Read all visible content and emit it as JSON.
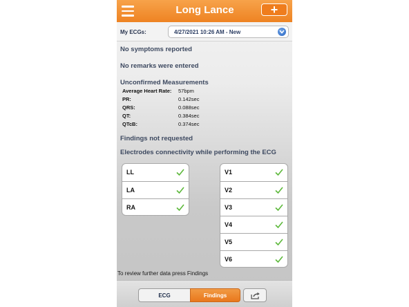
{
  "header": {
    "title": "Long Lance",
    "add_label": "+",
    "menu_icon": "hamburger-menu-icon"
  },
  "ecg_selector": {
    "label": "My ECGs:",
    "selected": "4/27/2021 10:26 AM - New",
    "icon": "chevron-down-circle-icon"
  },
  "notes": {
    "symptoms": "No symptoms reported",
    "remarks": "No remarks were entered"
  },
  "measurements": {
    "heading": "Unconfirmed Measurements",
    "rows": [
      {
        "label": "Average Heart Rate:",
        "value": "57bpm"
      },
      {
        "label": "PR:",
        "value": "0.142sec"
      },
      {
        "label": "QRS:",
        "value": "0.088sec"
      },
      {
        "label": "QT:",
        "value": "0.384sec"
      },
      {
        "label": "QTcB:",
        "value": "0.374sec"
      }
    ]
  },
  "findings_status": "Findings not requested",
  "electrodes": {
    "heading": "Electrodes connectivity while performing the ECG",
    "check_color": "#5cb83a",
    "left": [
      {
        "name": "LL",
        "connected": true
      },
      {
        "name": "LA",
        "connected": true
      },
      {
        "name": "RA",
        "connected": true
      }
    ],
    "right": [
      {
        "name": "V1",
        "connected": true
      },
      {
        "name": "V2",
        "connected": true
      },
      {
        "name": "V3",
        "connected": true
      },
      {
        "name": "V4",
        "connected": true
      },
      {
        "name": "V5",
        "connected": true
      },
      {
        "name": "V6",
        "connected": true
      }
    ]
  },
  "footer": {
    "hint": "To review further data press Findings",
    "tabs": [
      {
        "label": "ECG",
        "active": false
      },
      {
        "label": "Findings",
        "active": true
      }
    ],
    "share_icon": "share-export-icon"
  },
  "colors": {
    "accent": "#ee8322",
    "heading": "#3d4960"
  }
}
